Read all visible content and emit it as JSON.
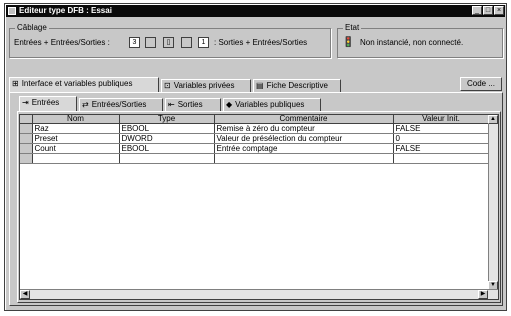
{
  "window": {
    "title": "Editeur type DFB : Essai",
    "controls": {
      "minimize": "_",
      "maximize": "□",
      "close": "×"
    }
  },
  "cablage": {
    "group_label": "Câblage",
    "left_text": "Entrées + Entrées/Sorties :",
    "count_in": "3",
    "count_out": "1",
    "right_text": ": Sorties + Entrées/Sorties"
  },
  "etat": {
    "group_label": "Etat",
    "status_text": "Non instancié, non connecté."
  },
  "main_tabs": [
    {
      "label": "Interface et variables publiques",
      "icon": "interface-icon"
    },
    {
      "label": "Variables privées",
      "icon": "private-vars-icon"
    },
    {
      "label": "Fiche Descriptive",
      "icon": "description-icon"
    }
  ],
  "code_button": "Code ...",
  "sub_tabs": [
    {
      "label": "Entrées",
      "icon": "inputs-icon"
    },
    {
      "label": "Entrées/Sorties",
      "icon": "in-out-icon"
    },
    {
      "label": "Sorties",
      "icon": "outputs-icon"
    },
    {
      "label": "Variables publiques",
      "icon": "public-vars-icon"
    }
  ],
  "table": {
    "columns": [
      "Nom",
      "Type",
      "Commentaire",
      "Valeur Init."
    ],
    "rows": [
      {
        "nom": "Raz",
        "type": "EBOOL",
        "commentaire": "Remise à zéro du compteur",
        "valeur": "FALSE"
      },
      {
        "nom": "Preset",
        "type": "DWORD",
        "commentaire": "Valeur de présélection du compteur",
        "valeur": "0"
      },
      {
        "nom": "Count",
        "type": "EBOOL",
        "commentaire": "Entrée comptage",
        "valeur": "FALSE"
      }
    ]
  }
}
